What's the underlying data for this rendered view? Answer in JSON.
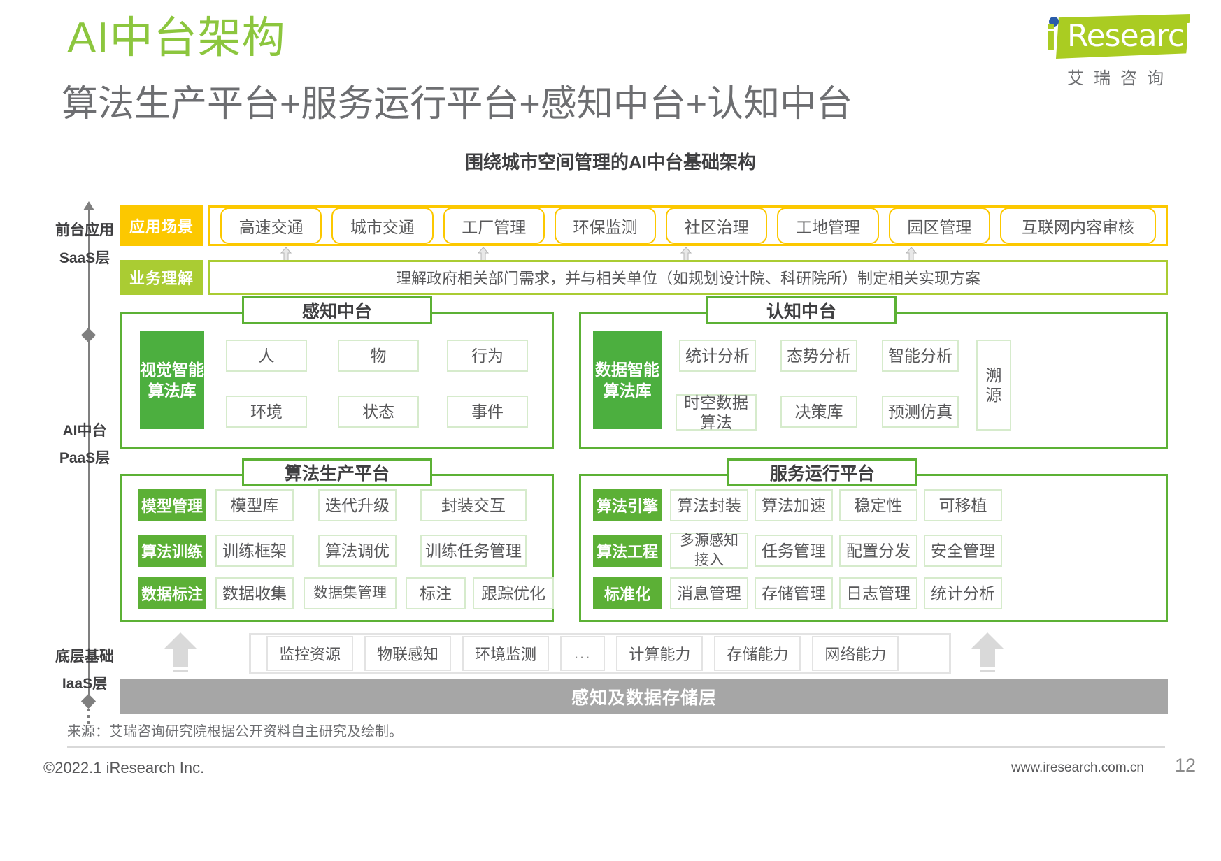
{
  "header": {
    "title": "AI中台架构",
    "subtitle": "算法生产平台+服务运行平台+感知中台+认知中台",
    "logo": {
      "i": "i",
      "word": "Research",
      "cn": "艾瑞咨询"
    }
  },
  "chart_data": {
    "type": "diagram",
    "title": "围绕城市空间管理的AI中台基础架构",
    "layers": [
      {
        "label_line1": "前台应用",
        "label_line2": "SaaS层"
      },
      {
        "label_line1": "AI中台",
        "label_line2": "PaaS层"
      },
      {
        "label_line1": "底层基础",
        "label_line2": "IaaS层"
      }
    ],
    "app_scenes": {
      "tag": "应用场景",
      "items": [
        "高速交通",
        "城市交通",
        "工厂管理",
        "环保监测",
        "社区治理",
        "工地管理",
        "园区管理",
        "互联网内容审核"
      ]
    },
    "business_understanding": {
      "tag": "业务理解",
      "text": "理解政府相关部门需求，并与相关单位（如规划设计院、科研院所）制定相关实现方案"
    },
    "perception_platform": {
      "title": "感知中台",
      "lead": "视觉智能算法库",
      "lead_line1": "视觉智能",
      "lead_line2": "算法库",
      "row1": [
        "人",
        "物",
        "行为"
      ],
      "row2": [
        "环境",
        "状态",
        "事件"
      ]
    },
    "cognition_platform": {
      "title": "认知中台",
      "lead": "数据智能算法库",
      "lead_line1": "数据智能",
      "lead_line2": "算法库",
      "row1": [
        "统计分析",
        "态势分析",
        "智能分析"
      ],
      "row2_line1": "时空数据",
      "row2_line2": "算法",
      "row2": [
        "时空数据算法",
        "决策库",
        "预测仿真"
      ],
      "side": "溯源",
      "side_line1": "溯",
      "side_line2": "源"
    },
    "algo_production_platform": {
      "title": "算法生产平台",
      "rows": [
        {
          "tag": "模型管理",
          "cells": [
            "模型库",
            "迭代升级",
            "封装交互"
          ]
        },
        {
          "tag": "算法训练",
          "cells": [
            "训练框架",
            "算法调优",
            "训练任务管理"
          ]
        },
        {
          "tag": "数据标注",
          "cells": [
            "数据收集",
            "数据集管理",
            "标注",
            "跟踪优化"
          ]
        }
      ]
    },
    "service_runtime_platform": {
      "title": "服务运行平台",
      "rows": [
        {
          "tag": "算法引擎",
          "cells": [
            "算法封装",
            "算法加速",
            "稳定性",
            "可移植"
          ]
        },
        {
          "tag": "算法工程",
          "cells": [
            "多源感知接入",
            "任务管理",
            "配置分发",
            "安全管理"
          ]
        },
        {
          "tag": "标准化",
          "cells": [
            "消息管理",
            "存储管理",
            "日志管理",
            "统计分析"
          ]
        }
      ],
      "multi_source_line1": "多源感知",
      "multi_source_line2": "接入"
    },
    "iaas": {
      "items": [
        "监控资源",
        "物联感知",
        "环境监测",
        "...",
        "计算能力",
        "存储能力",
        "网络能力"
      ],
      "bar": "感知及数据存储层"
    }
  },
  "footer": {
    "source": "来源：艾瑞咨询研究院根据公开资料自主研究及绘制。",
    "copyright": "©2022.1 iResearch Inc.",
    "website": "www.iresearch.com.cn",
    "page": "12"
  }
}
